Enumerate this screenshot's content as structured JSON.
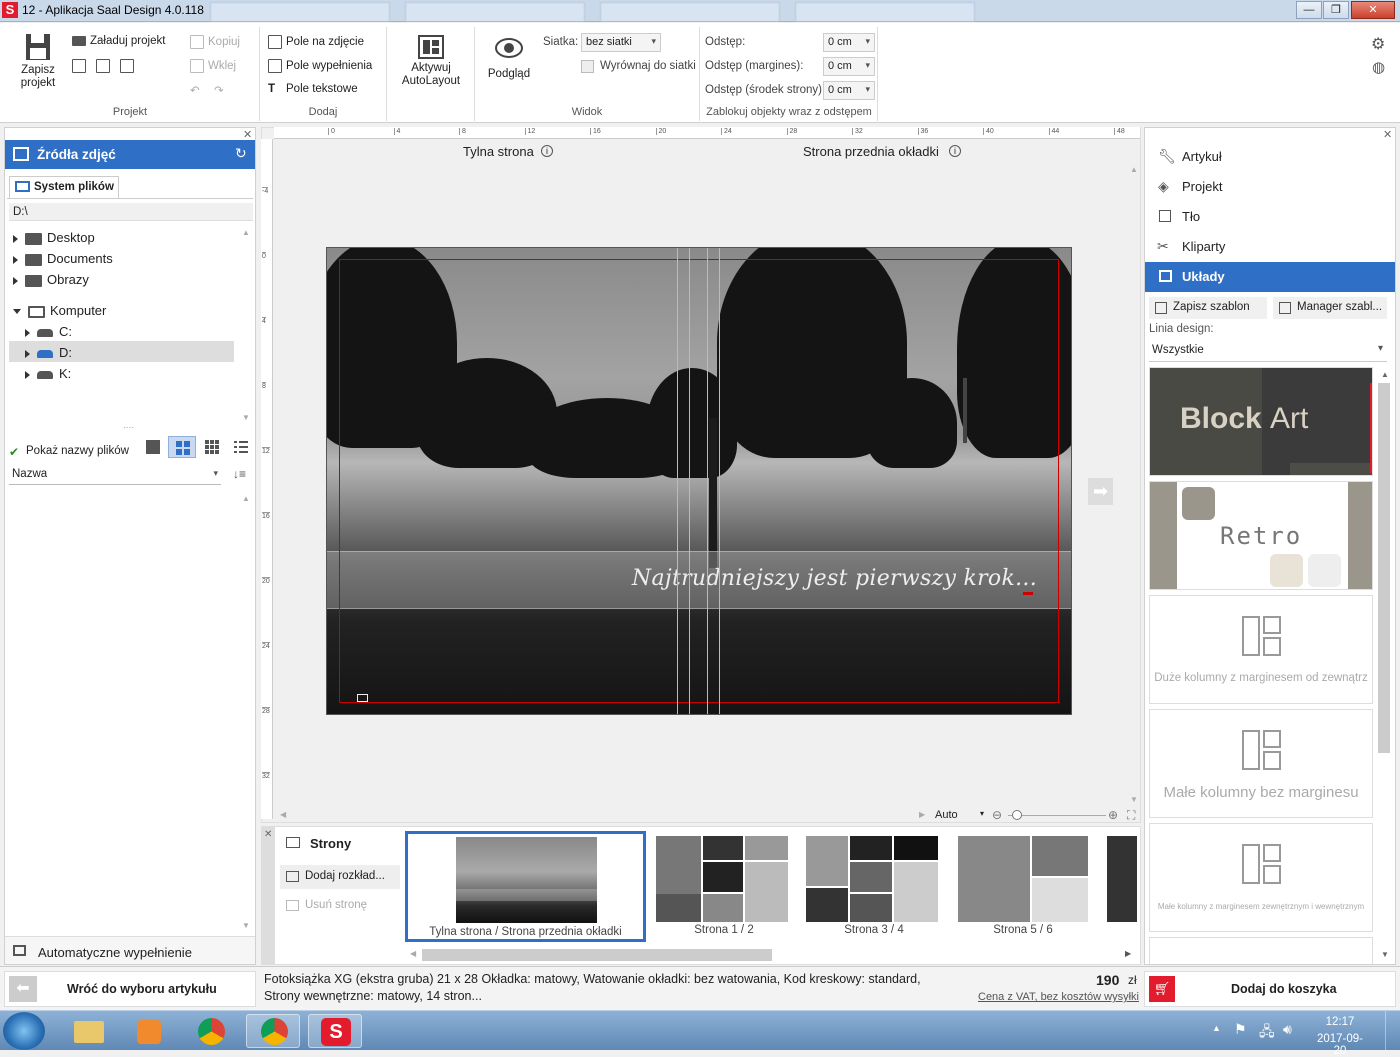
{
  "window": {
    "title": "12 - Aplikacja Saal Design 4.0.118",
    "app_logo": "S",
    "controls": [
      "minimize-icon",
      "maximize-icon",
      "close-icon"
    ]
  },
  "ribbon": {
    "projekt": {
      "label": "Projekt",
      "save": "Zapisz projekt",
      "save_line1": "Zapisz",
      "save_line2": "projekt",
      "load": "Załaduj projekt",
      "copy": "Kopiuj",
      "paste": "Wklej"
    },
    "dodaj": {
      "label": "Dodaj",
      "photo_field": "Pole na zdjęcie",
      "fill_field": "Pole wypełnienia",
      "text_field": "Pole tekstowe",
      "autolayout_line1": "Aktywuj",
      "autolayout_line2": "AutoLayout"
    },
    "widok": {
      "label": "Widok",
      "preview": "Podgląd",
      "grid_label": "Siatka:",
      "grid_value": "bez siatki",
      "align_to_grid": "Wyrównaj do siatki"
    },
    "spacing": {
      "label": "Zablokuj objekty wraz z odstępem",
      "gap_label": "Odstęp:",
      "gap_value": "0 cm",
      "margin_label": "Odstęp (margines):",
      "margin_value": "0 cm",
      "middle_label": "Odstęp (środek strony):",
      "middle_value": "0 cm"
    }
  },
  "left_panel": {
    "title": "Źródła zdjęć",
    "tab": "System plików",
    "path": "D:\\",
    "tree": [
      {
        "label": "Desktop",
        "type": "folder"
      },
      {
        "label": "Documents",
        "type": "folder"
      },
      {
        "label": "Obrazy",
        "type": "folder"
      },
      {
        "label": "Komputer",
        "type": "computer"
      },
      {
        "label": "C:",
        "type": "drive"
      },
      {
        "label": "D:",
        "type": "drive",
        "selected": true
      },
      {
        "label": "K:",
        "type": "drive"
      }
    ],
    "show_filenames": "Pokaż nazwy plików",
    "sort_value": "Nazwa",
    "autofill": "Automatyczne wypełnienie"
  },
  "canvas": {
    "back_label": "Tylna strona",
    "front_label": "Strona przednia okładki",
    "quote": "Najtrudniejszy jest pierwszy krok...",
    "ruler_top": [
      "0",
      "4",
      "8",
      "12",
      "16",
      "20",
      "24",
      "28",
      "32",
      "36",
      "40",
      "44",
      "48"
    ],
    "ruler_left": [
      "-4",
      "0",
      "4",
      "8",
      "12",
      "16",
      "20",
      "24",
      "28",
      "32"
    ],
    "zoom_value": "Auto"
  },
  "pages": {
    "title": "Strony",
    "add_spread": "Dodaj rozkład...",
    "remove_page": "Usuń stronę",
    "thumbs": [
      {
        "caption": "Tylna strona / Strona przednia okładki",
        "selected": true
      },
      {
        "caption": "Strona 1 / 2"
      },
      {
        "caption": "Strona 3 / 4"
      },
      {
        "caption": "Strona 5 / 6"
      }
    ]
  },
  "right_panel": {
    "nav": [
      {
        "label": "Artykuł",
        "icon": "wrench-icon"
      },
      {
        "label": "Projekt",
        "icon": "layers-icon"
      },
      {
        "label": "Tło",
        "icon": "background-icon"
      },
      {
        "label": "Kliparty",
        "icon": "clipart-icon"
      },
      {
        "label": "Układy",
        "icon": "layout-icon",
        "active": true
      }
    ],
    "save_template": "Zapisz szablon",
    "template_manager": "Manager szabl...",
    "design_line_label": "Linia design:",
    "design_line_value": "Wszystkie",
    "templates": [
      {
        "name_bold": "Block",
        "name_light": "Art"
      },
      {
        "name": "Retro"
      },
      {
        "caption": "Duże kolumny z marginesem od zewnątrz"
      },
      {
        "caption": "Małe kolumny bez marginesu"
      },
      {
        "caption": "Małe kolumny z marginesem zewnętrznym i wewnętrznym"
      }
    ]
  },
  "status": {
    "back_button": "Wróć do wyboru artykułu",
    "description_line1": "Fotoksiążka XG (ekstra gruba) 21 x 28 Okładka: matowy, Watowanie okładki: bez watowania, Kod kreskowy: standard,",
    "description_line2": "Strony wewnętrzne: matowy, 14 stron...",
    "price": "190",
    "currency": "zł",
    "price_note": "Cena z VAT, bez kosztów wysyłki",
    "add_to_cart": "Dodaj do koszyka"
  },
  "taskbar": {
    "time": "12:17",
    "date": "2017-09-20"
  },
  "colors": {
    "accent": "#2f6fc5",
    "brand_red": "#e21b2d"
  }
}
